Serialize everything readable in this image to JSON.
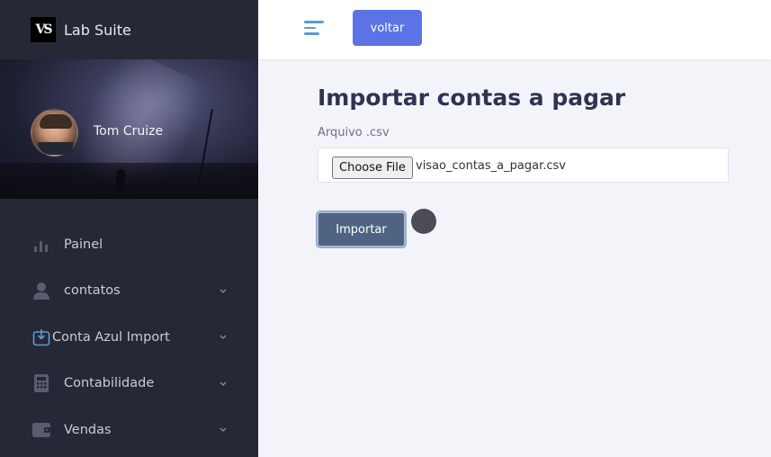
{
  "brand": {
    "logo_text": "VS",
    "name": "Lab Suite"
  },
  "profile": {
    "name": "Tom Cruize"
  },
  "menu": [
    {
      "label": "Painel",
      "icon": "bar-chart-icon",
      "has_submenu": false
    },
    {
      "label": "contatos",
      "icon": "user-icon",
      "has_submenu": true
    },
    {
      "label": "Conta Azul Import",
      "icon": "download-box-icon",
      "has_submenu": true
    },
    {
      "label": "Contabilidade",
      "icon": "calculator-icon",
      "has_submenu": true
    },
    {
      "label": "Vendas",
      "icon": "wallet-icon",
      "has_submenu": true
    }
  ],
  "topbar": {
    "back_label": "voltar"
  },
  "main": {
    "title": "Importar contas a pagar",
    "file_field_label": "Arquivo .csv",
    "choose_file_label": "Choose File",
    "file_name": "visao_contas_a_pagar.csv",
    "submit_label": "Importar"
  },
  "colors": {
    "sidebar_bg": "#262836",
    "accent": "#5c73e6",
    "submit_bg": "#4f6483",
    "icon_accent": "#5b9bd5"
  }
}
